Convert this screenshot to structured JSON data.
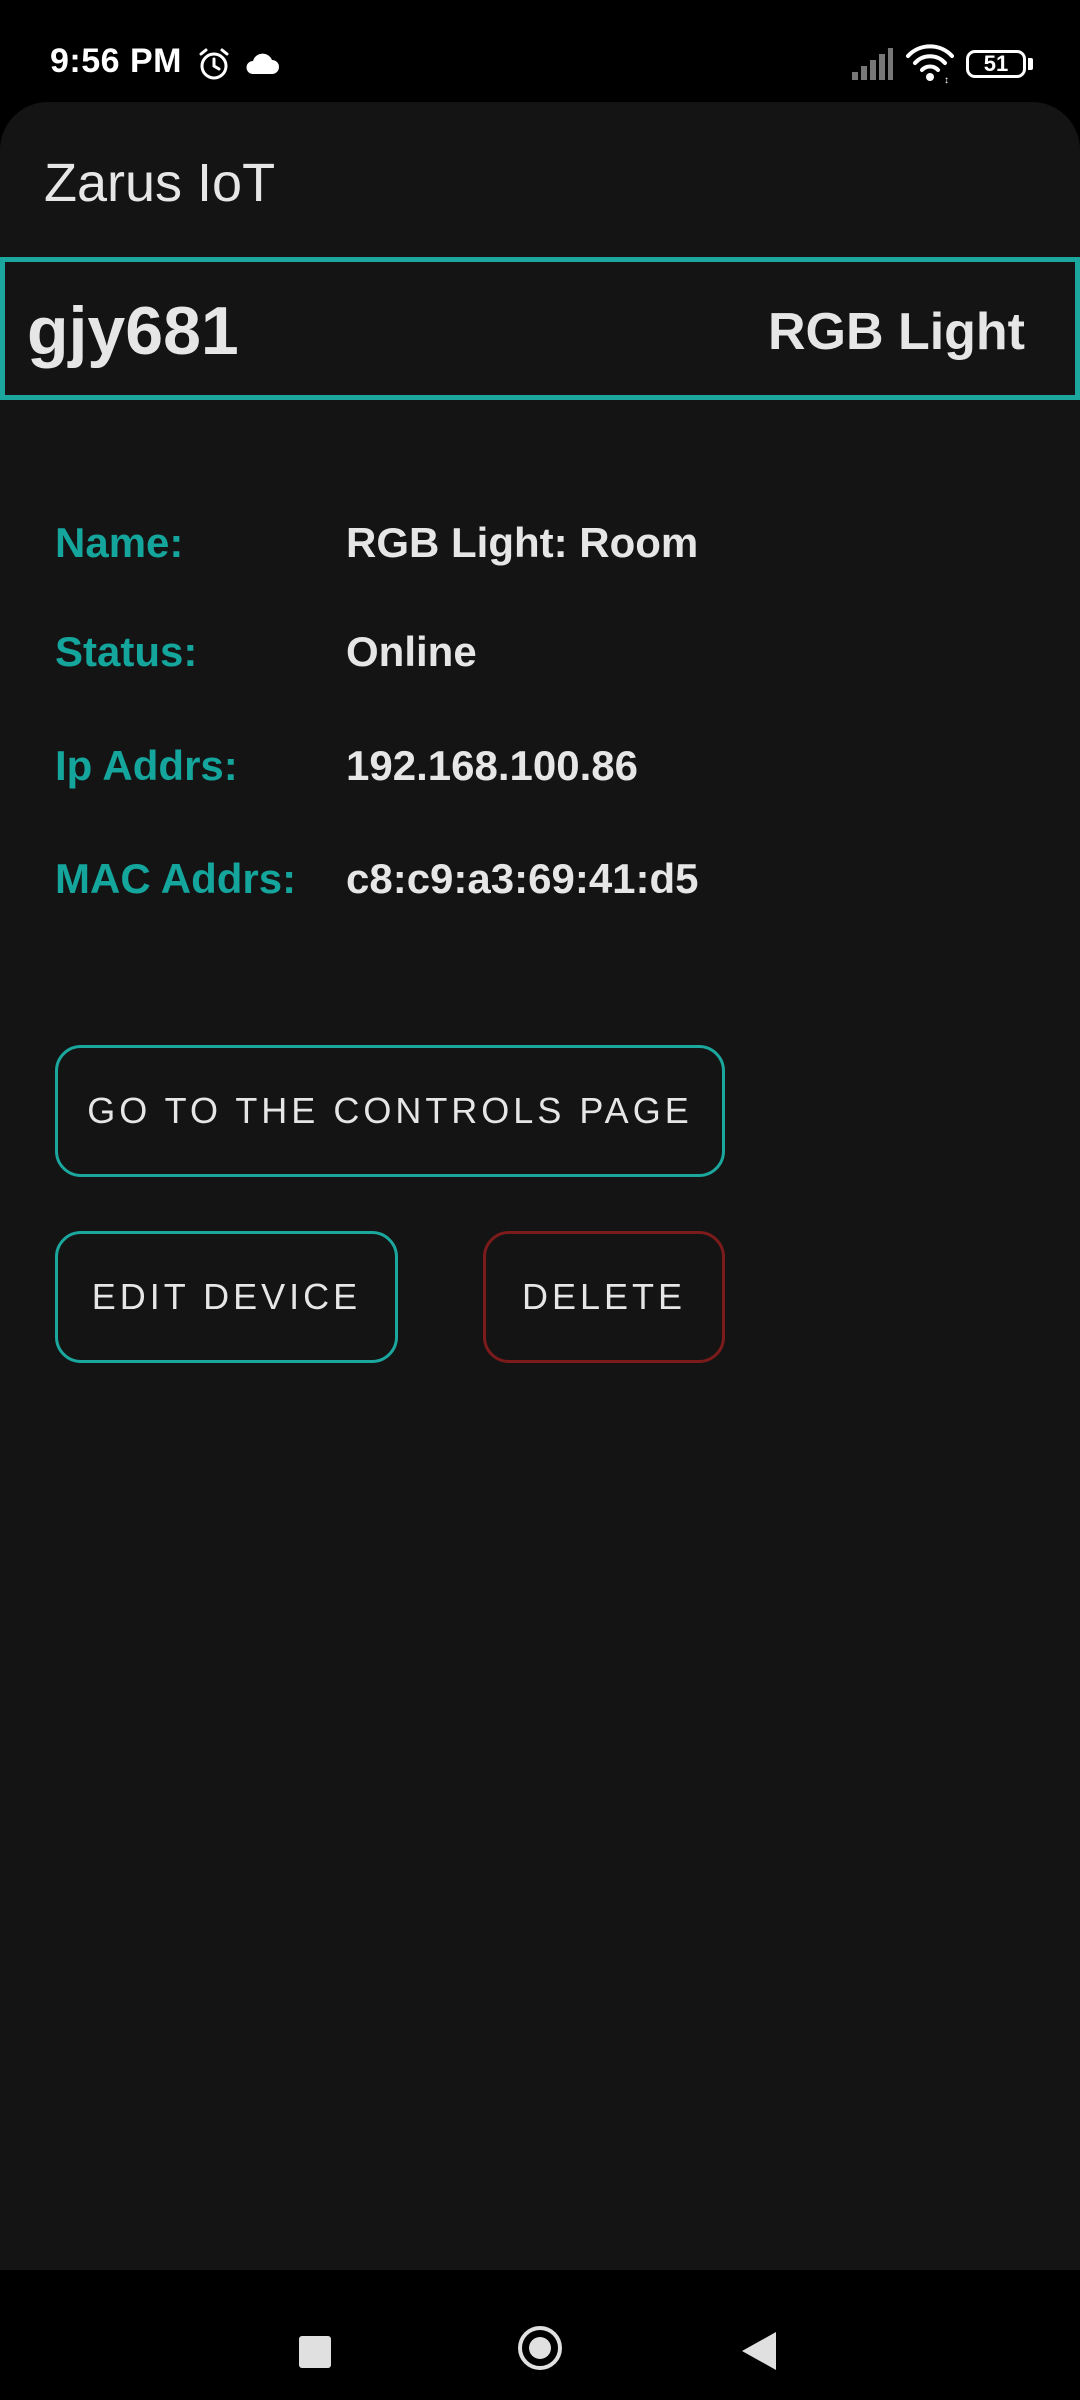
{
  "status_bar": {
    "time": "9:56 PM",
    "battery": "51",
    "icons": [
      "alarm-icon",
      "cloud-icon",
      "signal-icon",
      "wifi-icon",
      "battery-icon"
    ]
  },
  "app": {
    "title": "Zarus IoT"
  },
  "device": {
    "id": "gjy681",
    "type": "RGB Light"
  },
  "info": [
    {
      "label": "Name:",
      "value": "RGB Light: Room"
    },
    {
      "label": "Status:",
      "value": "Online"
    },
    {
      "label": "Ip Addrs:",
      "value": "192.168.100.86"
    },
    {
      "label": "MAC Addrs:",
      "value": "c8:c9:a3:69:41:d5"
    }
  ],
  "buttons": {
    "controls": "GO TO THE CONTROLS PAGE",
    "edit": "EDIT DEVICE",
    "delete": "DELETE"
  },
  "nav": {
    "icons": [
      "recents-icon",
      "home-icon",
      "back-icon"
    ]
  },
  "colors": {
    "accent": "#1ba79e",
    "label": "#14a59c",
    "delete_border": "#7c1b1b",
    "background": "#141414",
    "text": "#e6e6e6"
  }
}
